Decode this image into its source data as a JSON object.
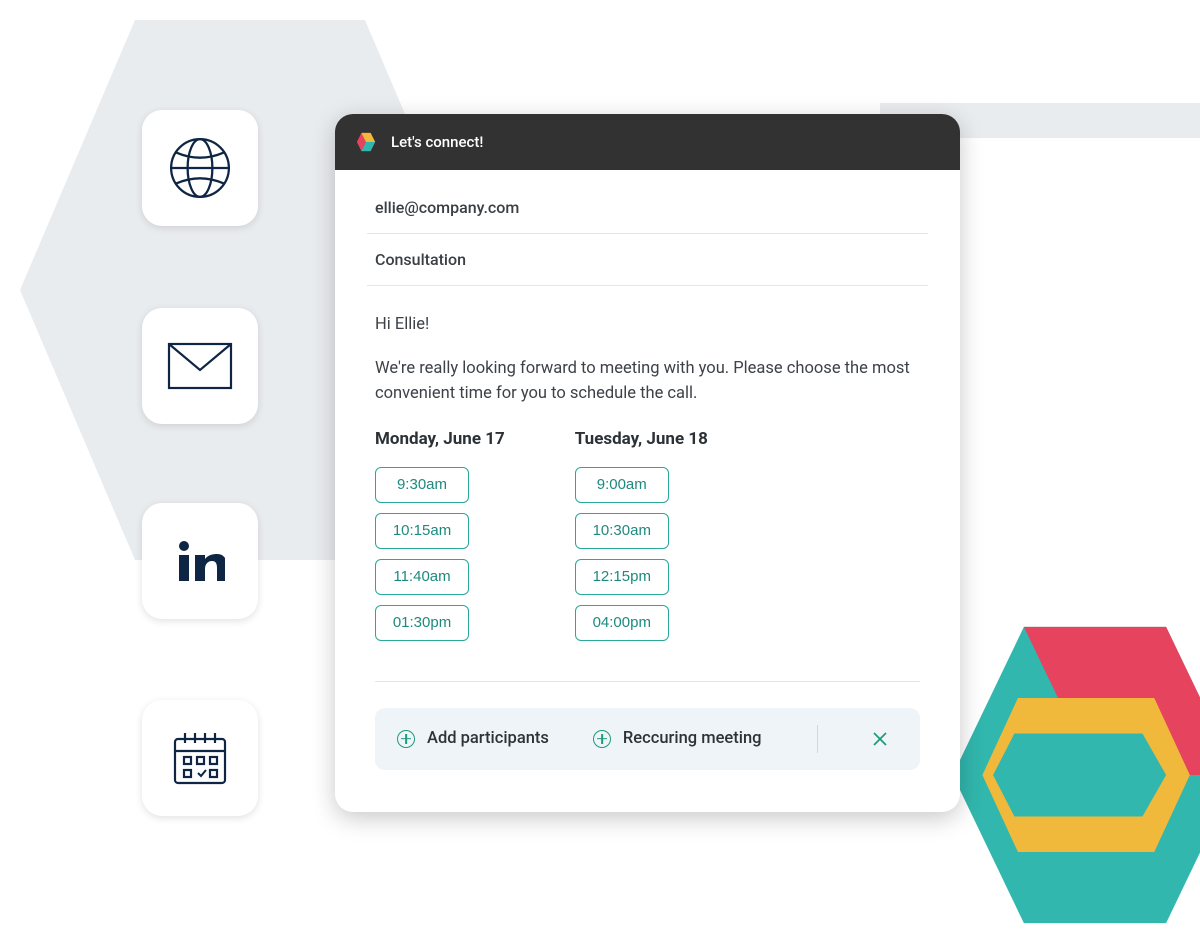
{
  "header": {
    "title": "Let's connect!"
  },
  "email": "ellie@company.com",
  "subject": "Consultation",
  "message": {
    "greeting": "Hi Ellie!",
    "body": "We're really looking forward to meeting with you. Please choose the most convenient time for you to schedule the call."
  },
  "days": [
    {
      "label": "Monday, June 17",
      "slots": [
        "9:30am",
        "10:15am",
        "11:40am",
        "01:30pm"
      ]
    },
    {
      "label": "Tuesday, June 18",
      "slots": [
        "9:00am",
        "10:30am",
        "12:15pm",
        "04:00pm"
      ]
    }
  ],
  "actions": {
    "add_participants": "Add participants",
    "recurring": "Reccuring meeting"
  },
  "icons": {
    "globe": "globe-icon",
    "mail": "mail-icon",
    "linkedin": "linkedin-icon",
    "calendar": "calendar-icon"
  }
}
